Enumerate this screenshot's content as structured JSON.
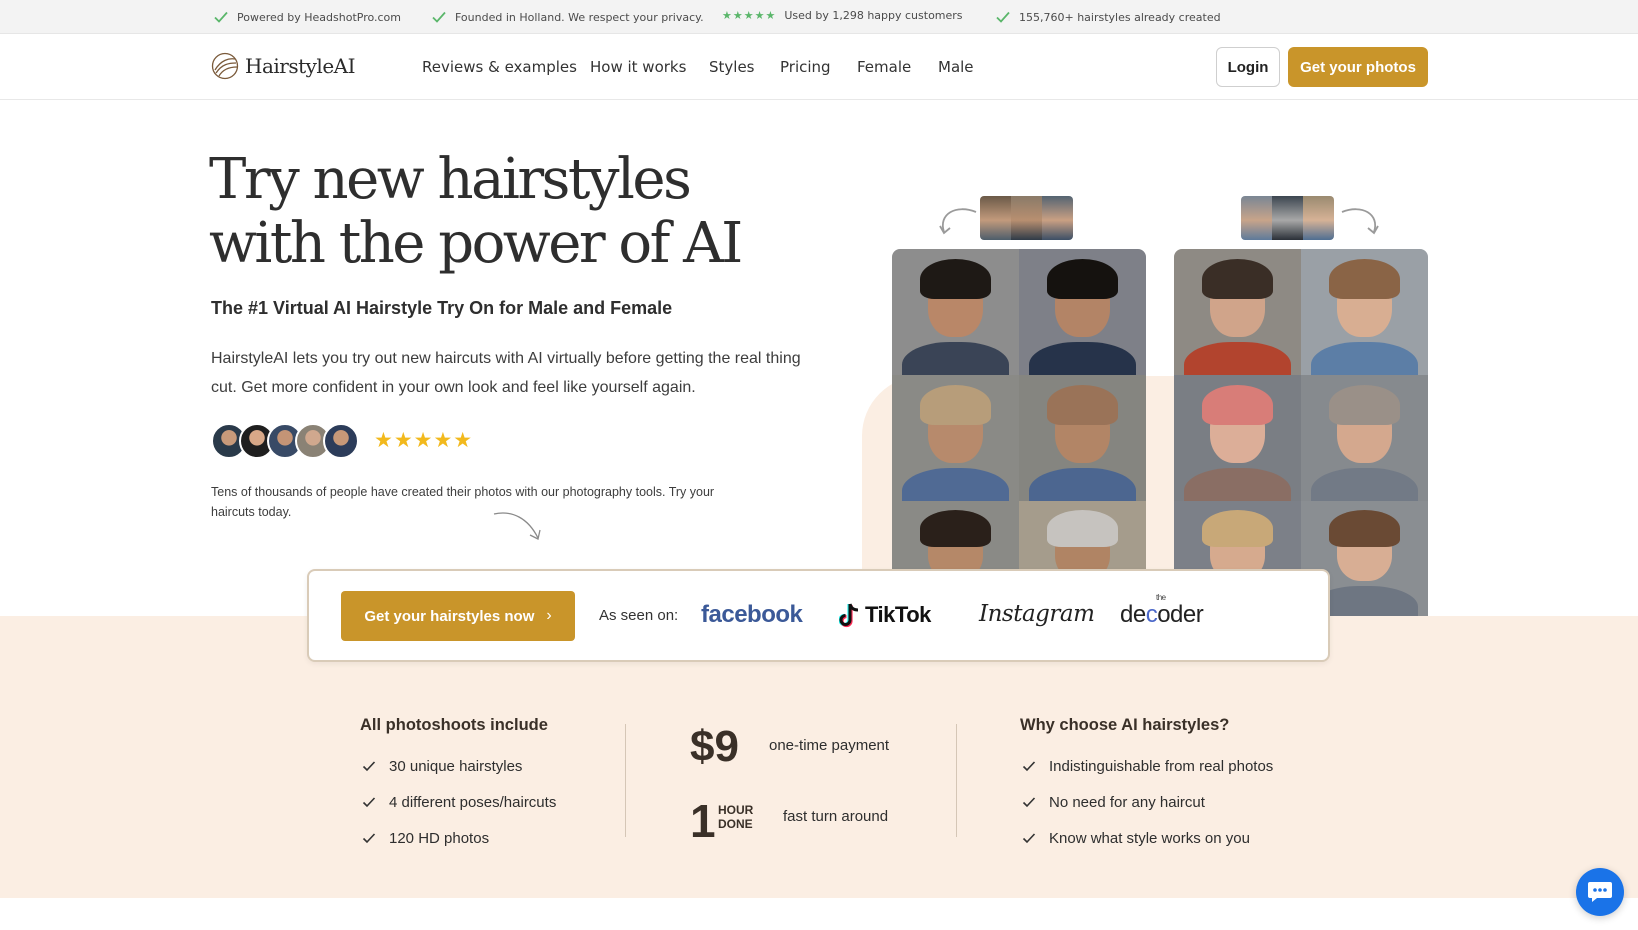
{
  "topbar": {
    "items": [
      "Powered by HeadshotPro.com",
      "Founded in Holland. We respect your privacy.",
      "Used by 1,298 happy customers",
      "155,760+ hairstyles already created"
    ],
    "stars": "★★★★★"
  },
  "header": {
    "logo_text": "HairstyleAI",
    "nav": [
      "Reviews & examples",
      "How it works",
      "Styles",
      "Pricing",
      "Female",
      "Male"
    ],
    "login_label": "Login",
    "cta_label": "Get your photos"
  },
  "hero": {
    "title_line1": "Try new hairstyles",
    "title_line2": "with the power of AI",
    "subtitle": "The #1 Virtual AI Hairstyle Try On for Male and Female",
    "description": "HairstyleAI lets you try out new haircuts with AI virtually before getting the real thing cut. Get more confident in your own look and feel like yourself again.",
    "stars": "★★★★★",
    "social_proof": "Tens of thousands of people have created their photos with our photography tools. Try your haircuts today."
  },
  "cta_card": {
    "button_label": "Get your hairstyles now",
    "button_chevron": "›",
    "as_seen_label": "As seen on:",
    "brands": {
      "facebook": "facebook",
      "tiktok": "TikTok",
      "instagram": "Instagram",
      "decoder_prefix": "de",
      "decoder_highlight": "c",
      "decoder_suffix": "oder",
      "decoder_the": "the"
    }
  },
  "features": {
    "left_title": "All photoshoots include",
    "left_items": [
      "30 unique hairstyles",
      "4 different poses/haircuts",
      "120 HD photos"
    ],
    "price": "$9",
    "price_desc": "one-time payment",
    "hour_num": "1",
    "hour_unit_1": "HOUR",
    "hour_unit_2": "DONE",
    "hour_desc": "fast turn around",
    "right_title": "Why choose AI hairstyles?",
    "right_items": [
      "Indistinguishable from real photos",
      "No need for any haircut",
      "Know what style works on you"
    ]
  },
  "colors": {
    "accent": "#c9952a",
    "band": "#fbeee3",
    "check_green": "#5ab66a",
    "star_yellow": "#f2b91d",
    "chat_blue": "#1a73e8"
  },
  "icons": {
    "check": "check-icon",
    "chat": "chat-icon",
    "logo": "logo-leaf-icon"
  }
}
